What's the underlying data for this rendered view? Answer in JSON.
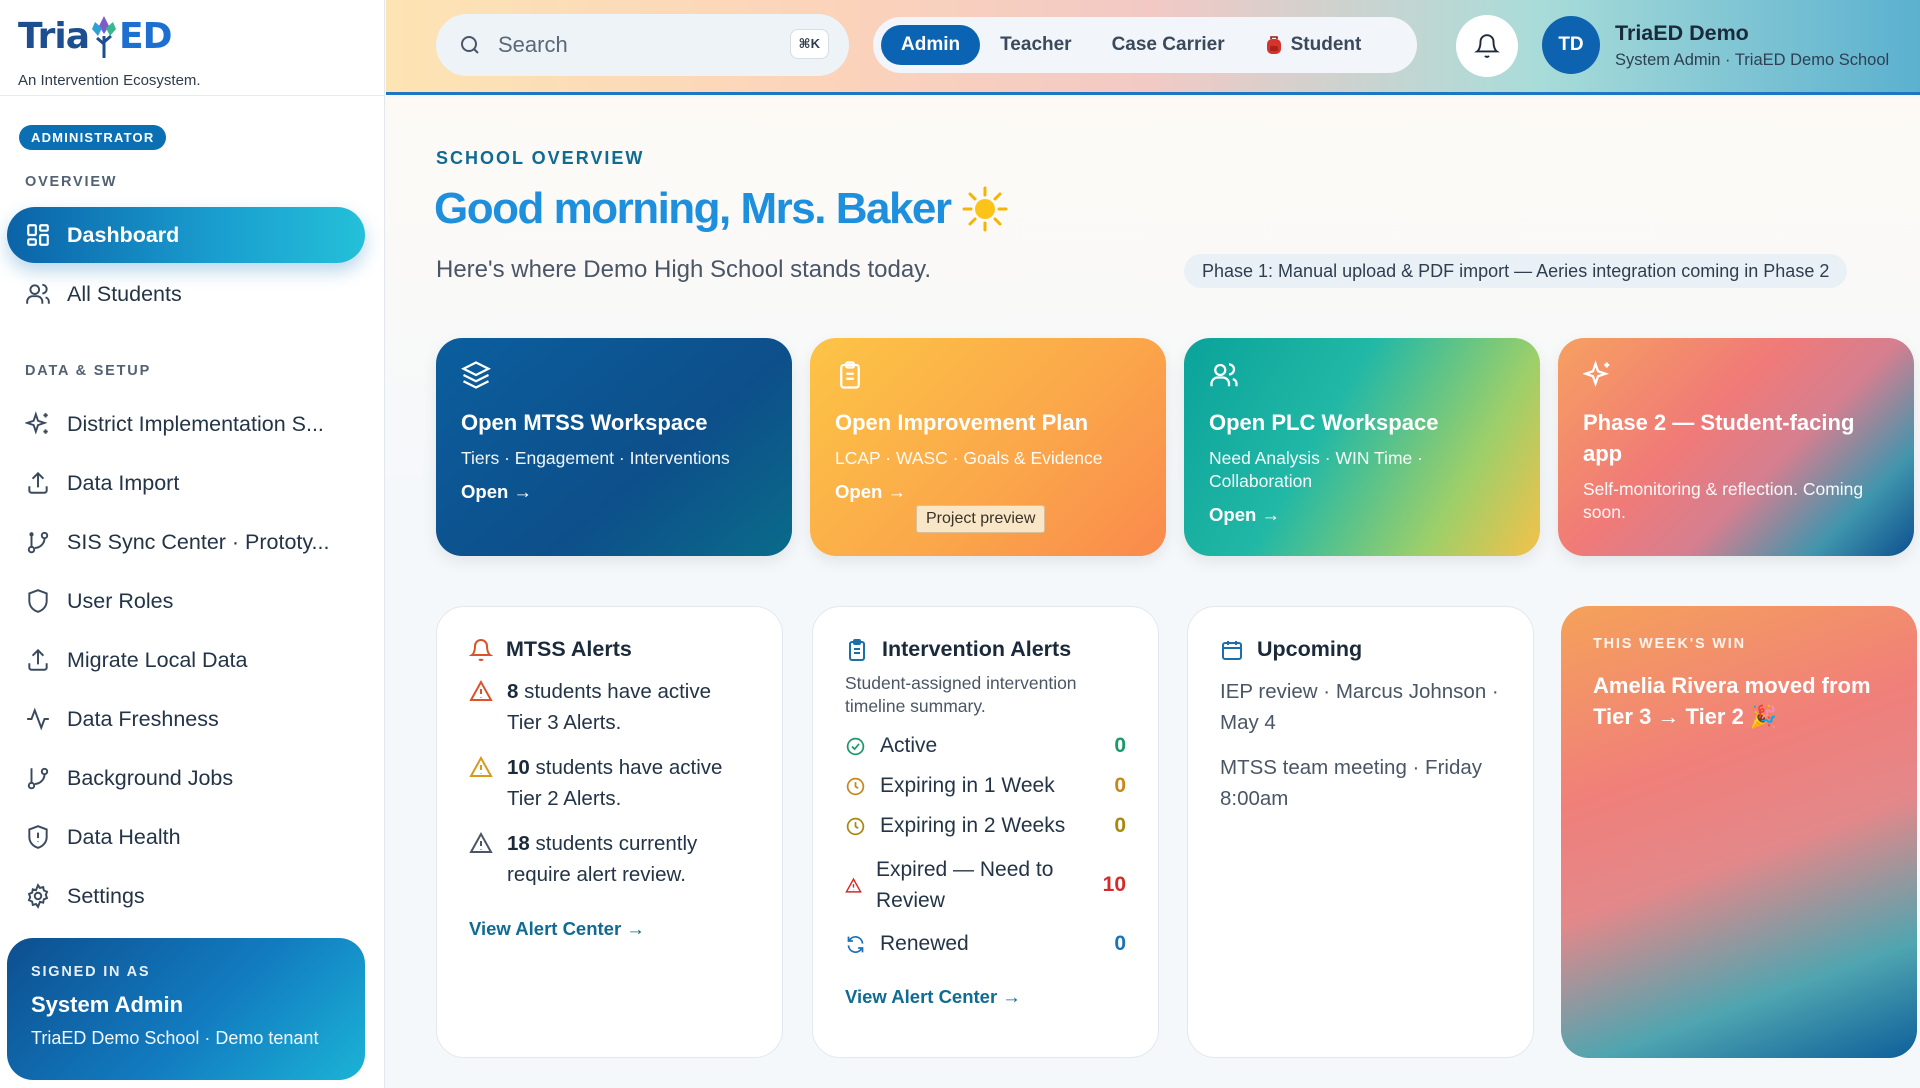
{
  "brand": {
    "name_a": "Tria",
    "name_b": "ED",
    "tagline": "An Intervention Ecosystem."
  },
  "sidebar": {
    "role_badge": "ADMINISTRATOR",
    "section_overview": "OVERVIEW",
    "section_data": "DATA & SETUP",
    "items": [
      {
        "label": "Dashboard",
        "icon": "grid-icon"
      },
      {
        "label": "All Students",
        "icon": "users-icon"
      },
      {
        "label": "District Implementation S...",
        "icon": "sparkles-icon"
      },
      {
        "label": "Data Import",
        "icon": "upload-icon"
      },
      {
        "label": "SIS Sync Center · Prototy...",
        "icon": "git-branch-icon"
      },
      {
        "label": "User Roles",
        "icon": "shield-icon"
      },
      {
        "label": "Migrate Local Data",
        "icon": "upload-icon"
      },
      {
        "label": "Data Freshness",
        "icon": "activity-icon"
      },
      {
        "label": "Background Jobs",
        "icon": "git-branch-icon"
      },
      {
        "label": "Data Health",
        "icon": "shield-alert-icon"
      },
      {
        "label": "Settings",
        "icon": "gear-icon"
      }
    ],
    "signed_in": {
      "kicker": "SIGNED IN AS",
      "name": "System Admin",
      "detail": "TriaED Demo School · Demo tenant"
    }
  },
  "header": {
    "search_placeholder": "Search",
    "search_shortcut": "⌘K",
    "roles": [
      "Admin",
      "Teacher",
      "Case Carrier",
      "Student"
    ],
    "active_role": "Admin",
    "user": {
      "initials": "TD",
      "name": "TriaED Demo",
      "role": "System Admin · TriaED Demo School"
    }
  },
  "main": {
    "eyebrow": "SCHOOL OVERVIEW",
    "greeting": "Good morning, Mrs. Baker",
    "subtitle": "Here's where Demo High School stands today.",
    "phase_note": "Phase 1: Manual upload & PDF import — Aeries integration coming in Phase 2",
    "quick_cards": [
      {
        "title": "Open MTSS Workspace",
        "desc": "Tiers · Engagement · Interventions",
        "cta": "Open →",
        "icon": "layers-icon"
      },
      {
        "title": "Open Improvement Plan",
        "desc": "LCAP · WASC · Goals & Evidence",
        "cta": "Open →",
        "icon": "clipboard-icon",
        "badge": "Project preview"
      },
      {
        "title": "Open PLC Workspace",
        "desc": "Need Analysis · WIN Time · Collaboration",
        "cta": "Open →",
        "icon": "users-icon"
      },
      {
        "title": "Phase 2 — Student-facing app",
        "desc": "Self-monitoring & reflection. Coming soon.",
        "icon": "sparkles-icon"
      }
    ],
    "mtss_alerts": {
      "title": "MTSS Alerts",
      "rows": [
        {
          "count": "8",
          "text": " students have active Tier 3 Alerts.",
          "color": "#d9542b"
        },
        {
          "count": "10",
          "text": " students have active Tier 2 Alerts.",
          "color": "#d99a1b"
        },
        {
          "count": "18",
          "text": " students currently require alert review.",
          "color": "#4a5665"
        }
      ],
      "link": "View Alert Center →"
    },
    "intervention_alerts": {
      "title": "Intervention Alerts",
      "desc": "Student-assigned intervention timeline summary.",
      "rows": [
        {
          "label": "Active",
          "value": "0",
          "color": "#1a9a6a"
        },
        {
          "label": "Expiring in 1 Week",
          "value": "0",
          "color": "#c9871a"
        },
        {
          "label": "Expiring in 2 Weeks",
          "value": "0",
          "color": "#a9880e"
        },
        {
          "label": "Expired — Need to Review",
          "value": "10",
          "color": "#d42a2a"
        },
        {
          "label": "Renewed",
          "value": "0",
          "color": "#1a72b8"
        }
      ],
      "link": "View Alert Center →"
    },
    "upcoming": {
      "title": "Upcoming",
      "items": [
        "IEP review · Marcus Johnson · May 4",
        "MTSS team meeting · Friday 8:00am"
      ]
    },
    "win": {
      "kicker": "THIS WEEK'S WIN",
      "message": "Amelia Rivera moved from Tier 3 → Tier 2 🎉"
    }
  }
}
